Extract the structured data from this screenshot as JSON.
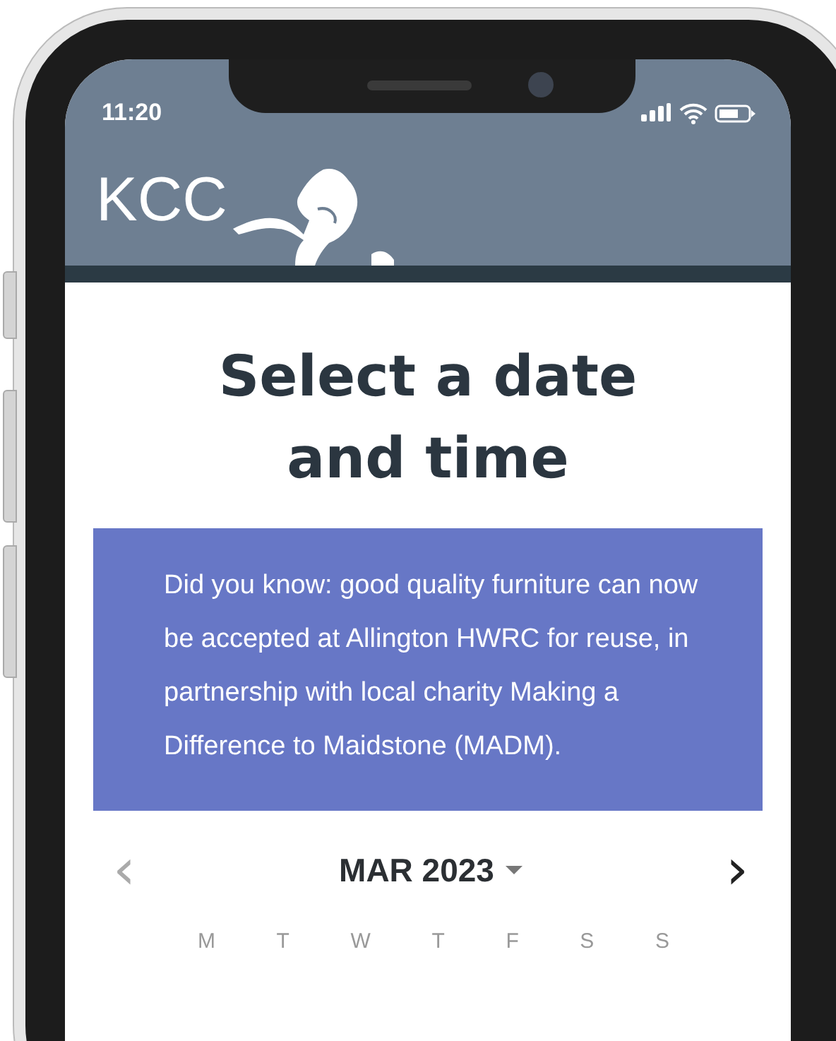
{
  "status_bar": {
    "time": "11:20"
  },
  "header": {
    "logo_text": "KCC"
  },
  "page": {
    "title": "Select a date and time",
    "info": "Did you know: good quality furniture can now be accepted at Allington HWRC for reuse, in partnership with local charity Making a Difference to Maidstone (MADM)."
  },
  "calendar": {
    "month": "MAR 2023",
    "prev": {
      "label": "‹",
      "disabled": true
    },
    "next": {
      "label": "›",
      "disabled": false
    },
    "weekdays": [
      "M",
      "T",
      "W",
      "T",
      "F",
      "S",
      "S"
    ]
  }
}
